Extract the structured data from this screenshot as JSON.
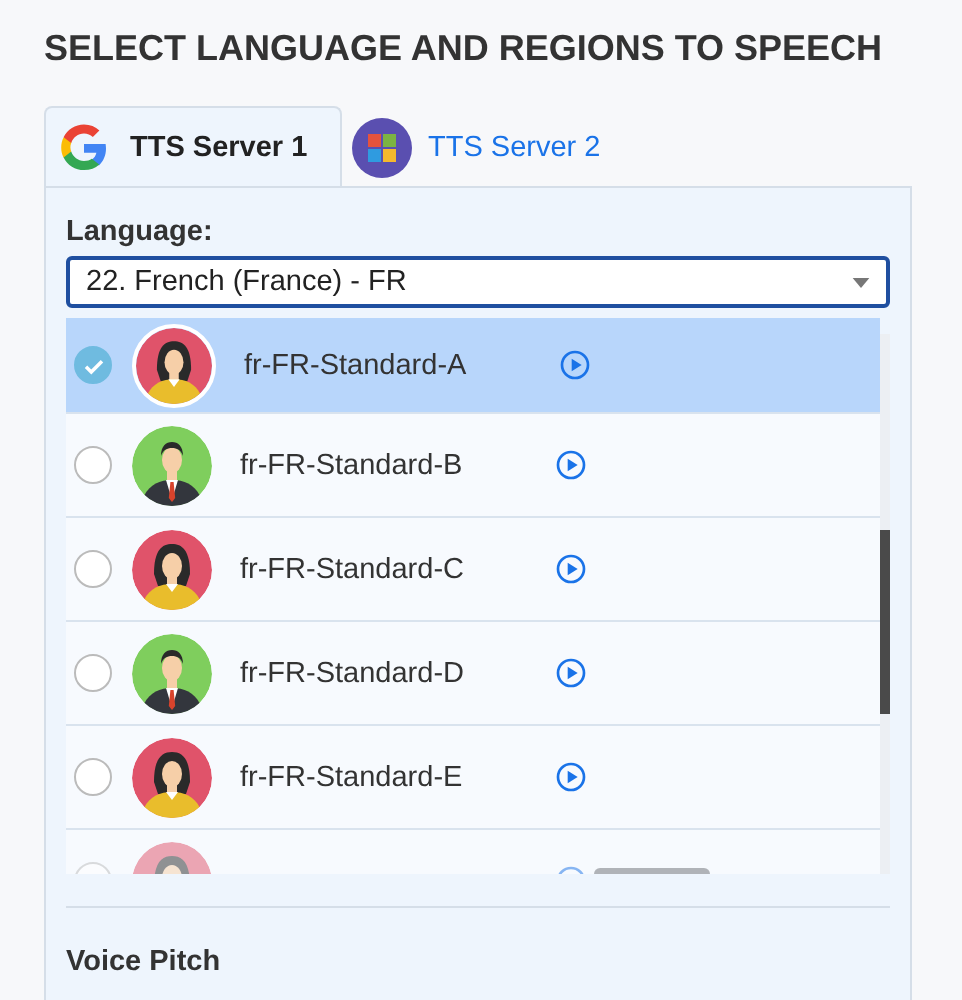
{
  "heading": "SELECT LANGUAGE AND REGIONS TO SPEECH",
  "tabs": [
    {
      "label": "TTS Server 1",
      "selected": true,
      "kind": "google"
    },
    {
      "label": "TTS Server 2",
      "selected": false,
      "kind": "tiles"
    }
  ],
  "language": {
    "label": "Language:",
    "value": "22. French (France) - FR"
  },
  "voices": [
    {
      "name": "fr-FR-Standard-A",
      "kind": "female",
      "selected": true
    },
    {
      "name": "fr-FR-Standard-B",
      "kind": "male",
      "selected": false
    },
    {
      "name": "fr-FR-Standard-C",
      "kind": "female",
      "selected": false
    },
    {
      "name": "fr-FR-Standard-D",
      "kind": "male",
      "selected": false
    },
    {
      "name": "fr-FR-Standard-E",
      "kind": "female",
      "selected": false
    },
    {
      "kind": "female",
      "selected": false,
      "faded": true
    }
  ],
  "pitch": {
    "label": "Voice Pitch"
  }
}
